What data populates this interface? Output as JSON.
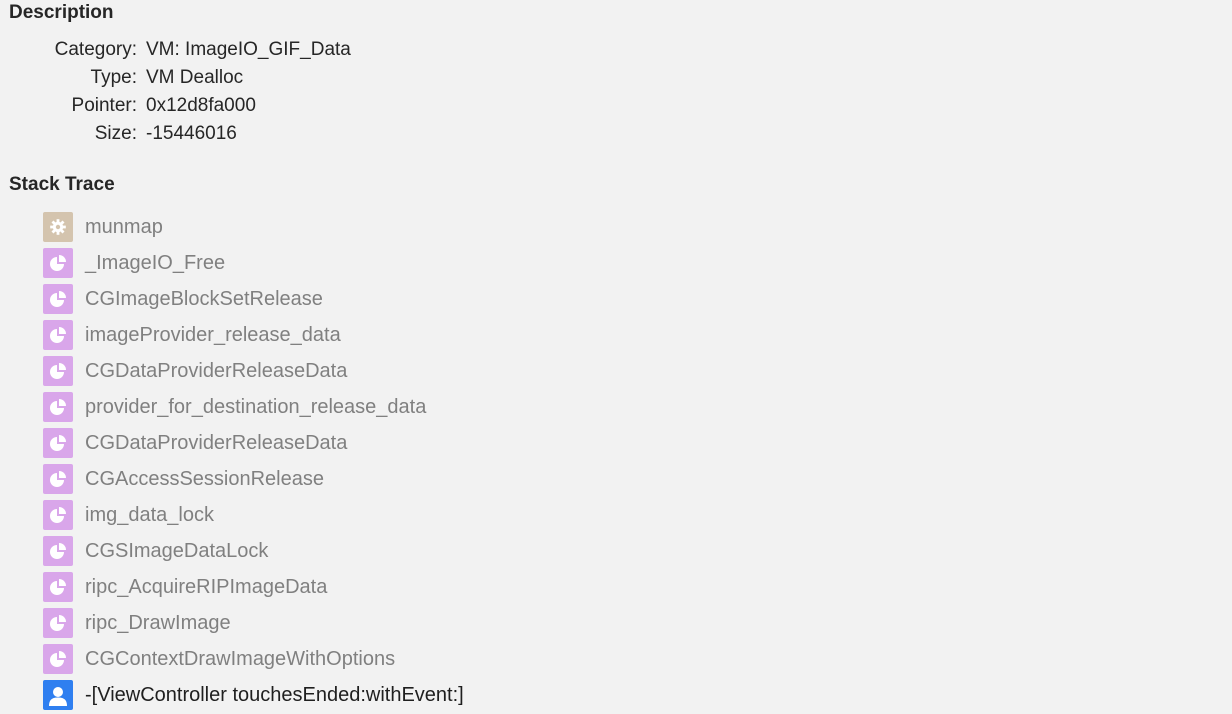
{
  "description": {
    "title": "Description",
    "rows": [
      {
        "key": "Category:",
        "value": "VM: ImageIO_GIF_Data"
      },
      {
        "key": "Type:",
        "value": "VM Dealloc"
      },
      {
        "key": "Pointer:",
        "value": "0x12d8fa000"
      },
      {
        "key": "Size:",
        "value": "-15446016"
      }
    ]
  },
  "stack_trace": {
    "title": "Stack Trace",
    "frames": [
      {
        "label": "munmap",
        "icon": "gear-icon",
        "kind": "system"
      },
      {
        "label": "_ImageIO_Free",
        "icon": "pie-icon",
        "kind": "framework"
      },
      {
        "label": "CGImageBlockSetRelease",
        "icon": "pie-icon",
        "kind": "framework"
      },
      {
        "label": "imageProvider_release_data",
        "icon": "pie-icon",
        "kind": "framework"
      },
      {
        "label": "CGDataProviderReleaseData",
        "icon": "pie-icon",
        "kind": "framework"
      },
      {
        "label": "provider_for_destination_release_data",
        "icon": "pie-icon",
        "kind": "framework"
      },
      {
        "label": "CGDataProviderReleaseData",
        "icon": "pie-icon",
        "kind": "framework"
      },
      {
        "label": "CGAccessSessionRelease",
        "icon": "pie-icon",
        "kind": "framework"
      },
      {
        "label": "img_data_lock",
        "icon": "pie-icon",
        "kind": "framework"
      },
      {
        "label": "CGSImageDataLock",
        "icon": "pie-icon",
        "kind": "framework"
      },
      {
        "label": "ripc_AcquireRIPImageData",
        "icon": "pie-icon",
        "kind": "framework"
      },
      {
        "label": "ripc_DrawImage",
        "icon": "pie-icon",
        "kind": "framework"
      },
      {
        "label": "CGContextDrawImageWithOptions",
        "icon": "pie-icon",
        "kind": "framework"
      },
      {
        "label": "-[ViewController touchesEnded:withEvent:]",
        "icon": "person-icon",
        "kind": "user"
      }
    ]
  },
  "colors": {
    "background": "#f2f2f2",
    "system_icon": "#d4c4ae",
    "framework_icon": "#d9a6ea",
    "user_icon": "#2f7ff0",
    "dim_text": "#808080",
    "text": "#262626"
  }
}
